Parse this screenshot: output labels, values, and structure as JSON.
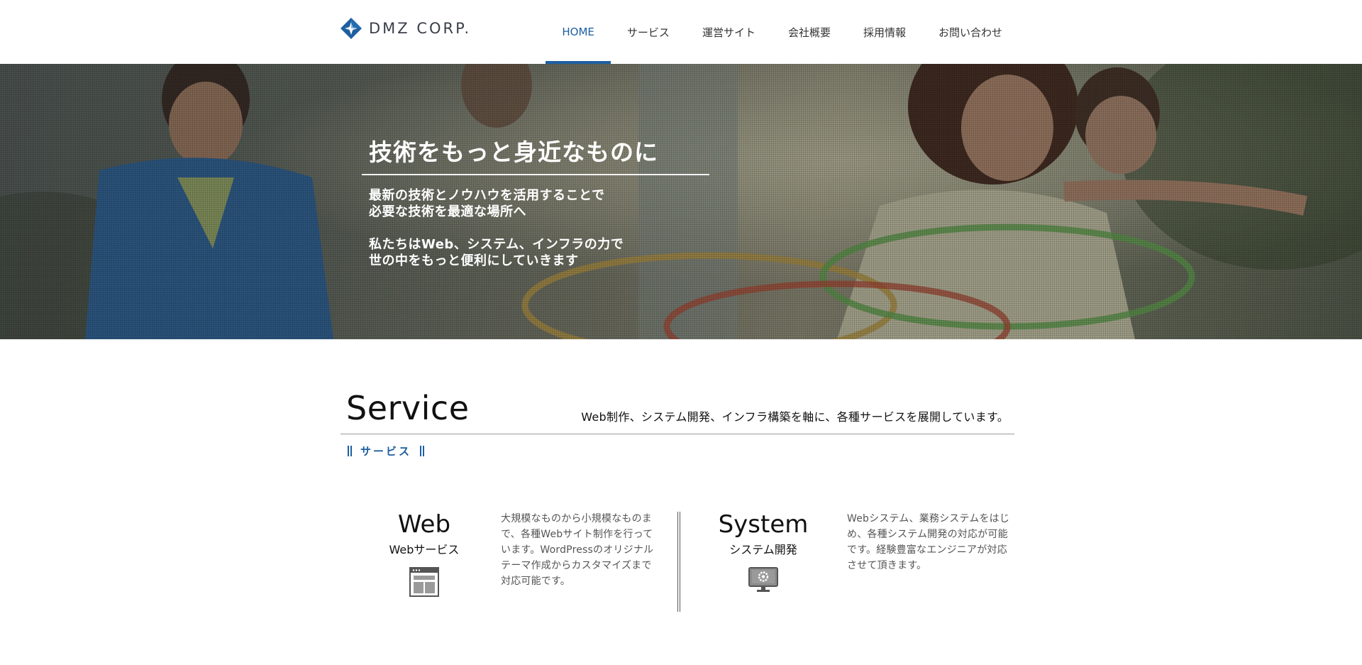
{
  "brand": {
    "name": "DMZ CORP.",
    "primary_color": "#1d5fa0",
    "logo_icon": "diamond-compass-logo"
  },
  "nav": {
    "items": [
      {
        "label": "HOME",
        "active": true
      },
      {
        "label": "サービス",
        "active": false
      },
      {
        "label": "運営サイト",
        "active": false
      },
      {
        "label": "会社概要",
        "active": false
      },
      {
        "label": "採用情報",
        "active": false
      },
      {
        "label": "お問い合わせ",
        "active": false
      }
    ]
  },
  "hero": {
    "title": "技術をもっと身近なものに",
    "copy_1": [
      "最新の技術とノウハウを活用することで",
      "必要な技術を最適な場所へ"
    ],
    "copy_2": [
      "私たちはWeb、システム、インフラの力で",
      "世の中をもっと便利にしていきます"
    ]
  },
  "service": {
    "title": "Service",
    "lead": "Web制作、システム開発、インフラ構築を軸に、各種サービスを展開しています。",
    "subtitle": "サービス",
    "cards": [
      {
        "title_en": "Web",
        "title_ja": "Webサービス",
        "icon": "browser-window-icon",
        "desc": [
          "大規模なものから小規模なものま",
          "で、各種Webサイト制作を行って",
          "います。WordPressのオリジナル",
          "テーマ作成からカスタマイズまで",
          "対応可能です。"
        ]
      },
      {
        "title_en": "System",
        "title_ja": "システム開発",
        "icon": "monitor-gear-icon",
        "desc": [
          "Webシステム、業務システムをはじ",
          "め、各種システム開発の対応が可能",
          "です。経験豊富なエンジニアが対応",
          "させて頂きます。"
        ]
      }
    ]
  }
}
